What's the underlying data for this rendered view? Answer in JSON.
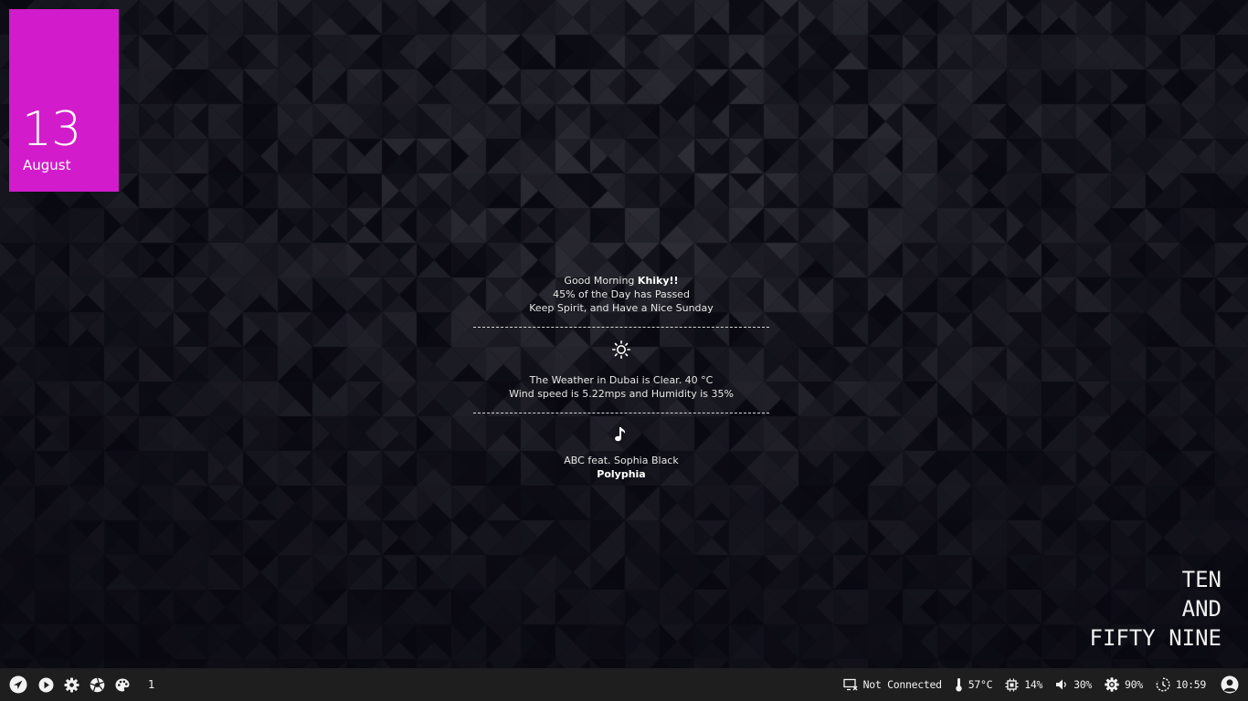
{
  "date": {
    "day": "13",
    "month": "August"
  },
  "colors": {
    "accent": "#d21ccb",
    "taskbar": "#1e1e1e",
    "background": "#0d0c15"
  },
  "greeting": {
    "prefix": "Good Morning ",
    "name": "Khiky!!",
    "progress": "45% of the Day has Passed",
    "message": "Keep Spirit, and Have a Nice Sunday"
  },
  "weather": {
    "icon": "sun-icon",
    "line1": "The Weather in Dubai is Clear. 40 °C",
    "line2": "Wind speed is 5.22mps and Humidity is 35%"
  },
  "music": {
    "icon": "music-note-icon",
    "artist": "ABC feat. Sophia Black",
    "title": "Polyphia"
  },
  "clock_words": {
    "line1": "TEN",
    "line2": "AND",
    "line3": "FIFTY NINE"
  },
  "taskbar": {
    "left_icons": [
      "rocket-icon",
      "play-icon",
      "gear-icon",
      "aperture-icon",
      "palette-icon"
    ],
    "workspace": "1",
    "network": "Not Connected",
    "temperature": "57°C",
    "cpu": "14%",
    "volume": "30%",
    "brightness": "90%",
    "time": "10:59"
  }
}
